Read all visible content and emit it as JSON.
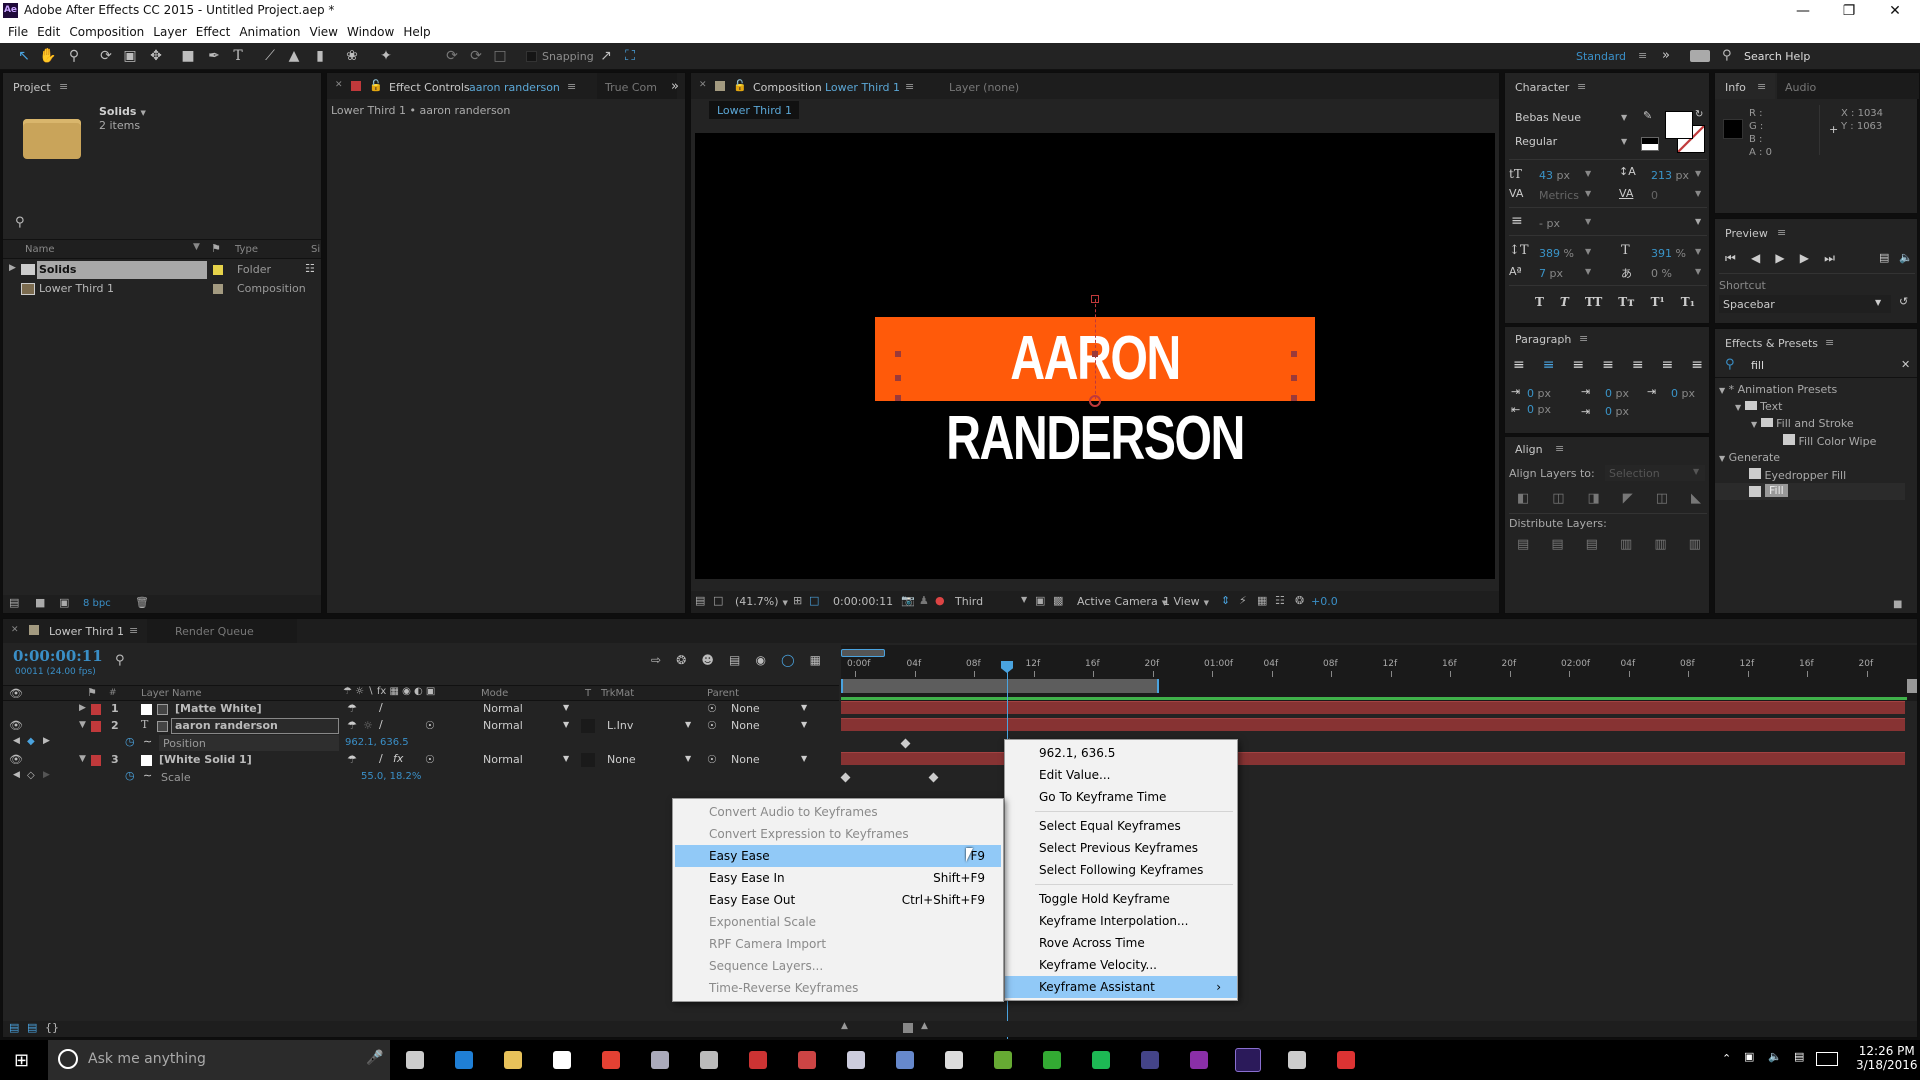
{
  "window": {
    "app_icon": "Ae",
    "title": "Adobe After Effects CC 2015 - Untitled Project.aep *",
    "controls": [
      "minimize",
      "restore",
      "close"
    ]
  },
  "menubar": [
    "File",
    "Edit",
    "Composition",
    "Layer",
    "Effect",
    "Animation",
    "View",
    "Window",
    "Help"
  ],
  "toolbar": {
    "tools": [
      "selection-tool",
      "hand-tool",
      "zoom-tool",
      "rotation-tool",
      "camera-tool",
      "pan-behind-tool",
      "rectangle-tool",
      "pen-tool",
      "type-tool",
      "brush-tool",
      "clone-stamp-tool",
      "eraser-tool",
      "roto-brush-tool",
      "puppet-pin-tool"
    ],
    "axis_tools": [
      "local-axis",
      "world-axis",
      "view-axis"
    ],
    "snapping_label": "Snapping",
    "workspace": "Standard",
    "search_help": "Search Help"
  },
  "project": {
    "title": "Project",
    "selected_name": "Solids",
    "selected_info": "2 items",
    "columns": [
      "Name",
      "Type",
      "Si"
    ],
    "items": [
      {
        "name": "Solids",
        "type": "Folder",
        "label_color": "#e6d34a",
        "selected": true
      },
      {
        "name": "Lower Third 1",
        "type": "Composition",
        "label_color": "#a39a80",
        "selected": false
      }
    ],
    "bpc": "8 bpc"
  },
  "effect_controls": {
    "tab_label": "Effect Controls",
    "layer": "aaron randerson",
    "breadcrumb": "Lower Third 1 • aaron randerson",
    "other_tab": "True Com"
  },
  "composition": {
    "tab_label": "Composition",
    "comp_name": "Lower Third 1",
    "layer_tab": "Layer (none)",
    "sub_tab": "Lower Third 1",
    "banner_text": "AARON RANDERSON",
    "banner_color": "#ff5a0a",
    "footer": {
      "zoom": "(41.7%)",
      "timecode": "0:00:00:11",
      "resolution": "Third",
      "camera": "Active Camera",
      "views": "1 View",
      "exposure": "+0.0"
    }
  },
  "character": {
    "title": "Character",
    "font": "Bebas Neue",
    "style": "Regular",
    "font_size": "43",
    "leading": "213",
    "kerning": "Metrics",
    "tracking": "0",
    "stroke_width": "-",
    "vert_scale": "389",
    "horiz_scale": "391",
    "baseline_shift": "7",
    "tsume": "0",
    "unit_px": "px",
    "unit_pct": "%",
    "style_buttons": [
      "T",
      "T",
      "TT",
      "Tт",
      "T¹",
      "T₁"
    ]
  },
  "paragraph": {
    "title": "Paragraph",
    "indent_values": [
      "0",
      "0",
      "0",
      "0",
      "0"
    ],
    "unit": "px"
  },
  "align": {
    "title": "Align",
    "align_to_label": "Align Layers to:",
    "align_to_value": "Selection",
    "distribute_label": "Distribute Layers:"
  },
  "info": {
    "title": "Info",
    "audio_tab": "Audio",
    "r": "R :",
    "g": "G :",
    "b": "B :",
    "a": "A : 0",
    "x": "X : 1034",
    "y": "Y : 1063"
  },
  "preview": {
    "title": "Preview",
    "shortcut_label": "Shortcut",
    "shortcut_value": "Spacebar"
  },
  "effects_presets": {
    "title": "Effects & Presets",
    "search": "fill",
    "tree": [
      {
        "label": "* Animation Presets",
        "level": 0,
        "kind": "group"
      },
      {
        "label": "Text",
        "level": 1,
        "kind": "folder"
      },
      {
        "label": "Fill and Stroke",
        "level": 2,
        "kind": "folder"
      },
      {
        "label": "Fill Color Wipe",
        "level": 3,
        "kind": "preset"
      },
      {
        "label": "Generate",
        "level": 0,
        "kind": "group"
      },
      {
        "label": "Eyedropper Fill",
        "level": 1,
        "kind": "effect"
      },
      {
        "label": "Fill",
        "level": 1,
        "kind": "effect",
        "selected": true
      }
    ]
  },
  "timeline": {
    "tab_label": "Lower Third 1",
    "render_queue": "Render Queue",
    "timecode": "0:00:00:11",
    "frame_info": "00011 (24.00 fps)",
    "columns": {
      "layer_name": "Layer Name",
      "mode": "Mode",
      "t": "T",
      "trkmat": "TrkMat",
      "parent": "Parent"
    },
    "ruler": [
      "0:00f",
      "04f",
      "08f",
      "12f",
      "16f",
      "20f",
      "01:00f",
      "04f",
      "08f",
      "12f",
      "16f",
      "20f",
      "02:00f",
      "04f",
      "08f",
      "12f",
      "16f",
      "20f"
    ],
    "playhead_frame": 11,
    "layers": [
      {
        "num": "1",
        "name": "[Matte White]",
        "mode": "Normal",
        "trkmat": "",
        "parent": "None"
      },
      {
        "num": "2",
        "name": "aaron randerson",
        "mode": "Normal",
        "trkmat": "L.Inv",
        "parent": "None",
        "prop": "Position",
        "prop_value": "962.1, 636.5"
      },
      {
        "num": "3",
        "name": "[White Solid 1]",
        "mode": "Normal",
        "trkmat": "None",
        "parent": "None",
        "prop": "Scale",
        "prop_value": "55.0, 18.2%"
      }
    ]
  },
  "context_menu": {
    "items": [
      {
        "label": "962.1, 636.5"
      },
      {
        "label": "Edit Value..."
      },
      {
        "label": "Go To Keyframe Time",
        "sep_after": true
      },
      {
        "label": "Select Equal Keyframes"
      },
      {
        "label": "Select Previous Keyframes"
      },
      {
        "label": "Select Following Keyframes",
        "sep_after": true
      },
      {
        "label": "Toggle Hold Keyframe"
      },
      {
        "label": "Keyframe Interpolation..."
      },
      {
        "label": "Rove Across Time"
      },
      {
        "label": "Keyframe Velocity..."
      },
      {
        "label": "Keyframe Assistant",
        "highlighted": true,
        "submenu": true
      }
    ]
  },
  "submenu": {
    "items": [
      {
        "label": "Convert Audio to Keyframes",
        "disabled": true
      },
      {
        "label": "Convert Expression to Keyframes",
        "disabled": true
      },
      {
        "label": "Easy Ease",
        "shortcut": "F9",
        "highlighted": true
      },
      {
        "label": "Easy Ease In",
        "shortcut": "Shift+F9"
      },
      {
        "label": "Easy Ease Out",
        "shortcut": "Ctrl+Shift+F9"
      },
      {
        "label": "Exponential Scale",
        "disabled": true
      },
      {
        "label": "RPF Camera Import",
        "disabled": true
      },
      {
        "label": "Sequence Layers...",
        "disabled": true
      },
      {
        "label": "Time-Reverse Keyframes",
        "disabled": true
      }
    ]
  },
  "taskbar": {
    "search_placeholder": "Ask me anything",
    "time": "12:26 PM",
    "date": "3/18/2016",
    "apps": [
      "task-view",
      "edge",
      "file-explorer",
      "store",
      "chrome",
      "app-6",
      "app-7",
      "app-8",
      "app-9",
      "app-10",
      "app-11",
      "app-12",
      "app-13",
      "app-14",
      "spotify",
      "app-16",
      "onenote",
      "after-effects",
      "app-19",
      "app-20"
    ]
  }
}
